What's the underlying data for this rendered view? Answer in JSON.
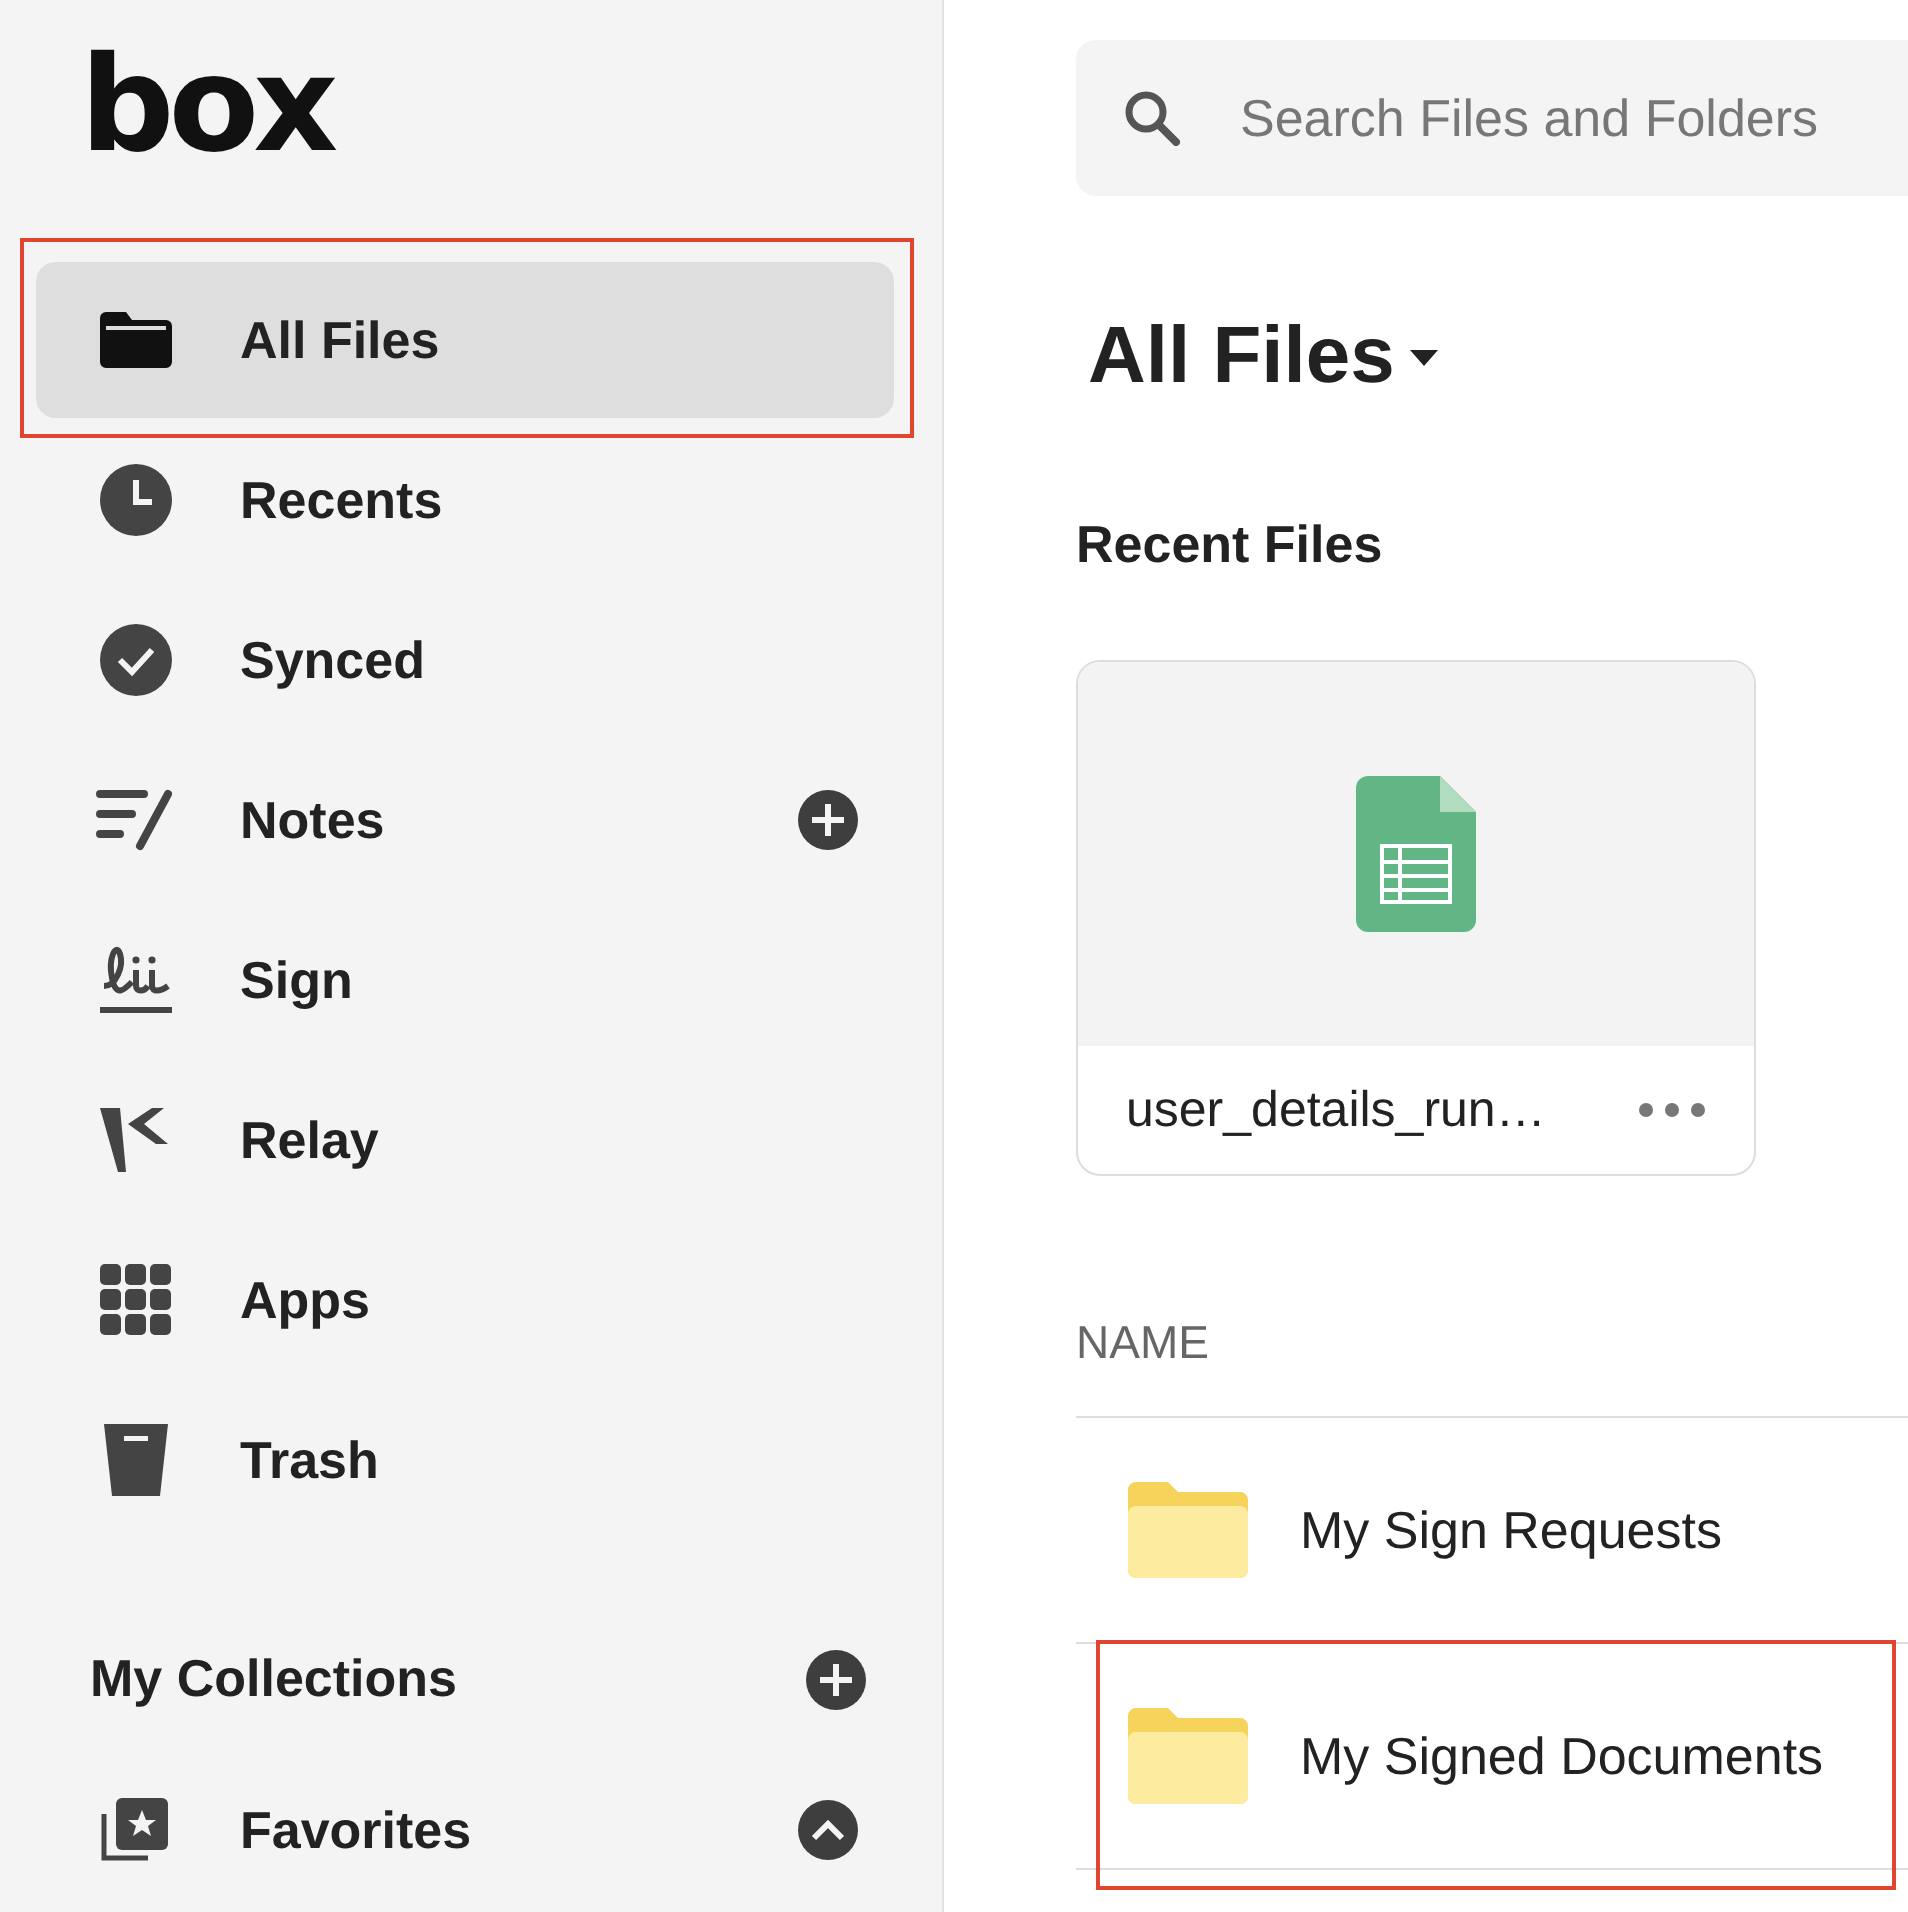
{
  "logo": "box",
  "sidebar": {
    "items": [
      {
        "label": "All Files",
        "selected": true,
        "highlighted": true,
        "add": false
      },
      {
        "label": "Recents",
        "selected": false,
        "highlighted": false,
        "add": false
      },
      {
        "label": "Synced",
        "selected": false,
        "highlighted": false,
        "add": false
      },
      {
        "label": "Notes",
        "selected": false,
        "highlighted": false,
        "add": true
      },
      {
        "label": "Sign",
        "selected": false,
        "highlighted": false,
        "add": false
      },
      {
        "label": "Relay",
        "selected": false,
        "highlighted": false,
        "add": false
      },
      {
        "label": "Apps",
        "selected": false,
        "highlighted": false,
        "add": false
      },
      {
        "label": "Trash",
        "selected": false,
        "highlighted": false,
        "add": false
      }
    ],
    "collections": {
      "title": "My Collections",
      "items": [
        {
          "label": "Favorites",
          "expanded": true
        }
      ]
    }
  },
  "search": {
    "placeholder": "Search Files and Folders"
  },
  "title": "All Files",
  "recent": {
    "title": "Recent Files",
    "files": [
      {
        "name": "user_details_run…"
      }
    ]
  },
  "table": {
    "columns": [
      "NAME"
    ],
    "rows": [
      {
        "name": "My Sign Requests",
        "highlighted": false
      },
      {
        "name": "My Signed Documents",
        "highlighted": true
      }
    ]
  }
}
